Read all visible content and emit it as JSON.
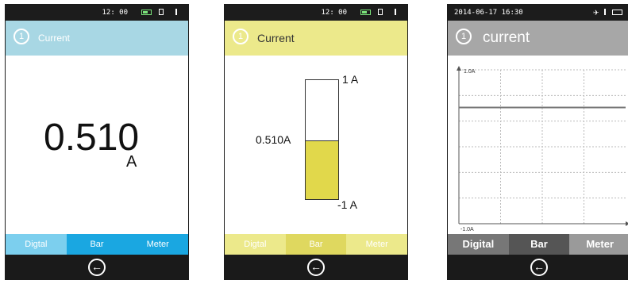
{
  "panels": [
    {
      "status": {
        "time": "12: 00"
      },
      "header": {
        "badge": "1",
        "title": "Current"
      },
      "reading": {
        "value": "0.510",
        "unit": "A"
      },
      "tabs": [
        {
          "label": "Digtal"
        },
        {
          "label": "Bar"
        },
        {
          "label": "Meter"
        }
      ],
      "active_tab": "Digtal"
    },
    {
      "status": {
        "time": "12: 00"
      },
      "header": {
        "badge": "1",
        "title": "Current"
      },
      "bar": {
        "max_label": "1 A",
        "min_label": "-1 A",
        "value_label": "0.510A",
        "value": 0.51,
        "min": -1,
        "max": 1
      },
      "tabs": [
        {
          "label": "Digtal"
        },
        {
          "label": "Bar"
        },
        {
          "label": "Meter"
        }
      ],
      "active_tab": "Bar"
    },
    {
      "status": {
        "date": "2014-06-17 16:30"
      },
      "header": {
        "badge": "1",
        "title": "current"
      },
      "tabs": [
        {
          "label": "Digital"
        },
        {
          "label": "Bar"
        },
        {
          "label": "Meter"
        }
      ],
      "active_tab": "Digital"
    }
  ],
  "chart_data": {
    "type": "line",
    "ylabel": "",
    "xlabel": "",
    "ymax_label": "1.0A",
    "ymin_label": "-1.0A",
    "ylim": [
      -1.0,
      1.0
    ],
    "grid": true,
    "series": [
      {
        "values": [
          0.51,
          0.51
        ]
      }
    ]
  },
  "colors": {
    "digital_header": "#a8d7e4",
    "digital_tabbar": "#1aa7e1",
    "bar_header": "#ece98b",
    "bar_fill": "#e1d84b",
    "chart_header": "#a7a7a7"
  },
  "icons": {
    "back": "back-arrow-icon",
    "badge": "circle-number-icon"
  }
}
